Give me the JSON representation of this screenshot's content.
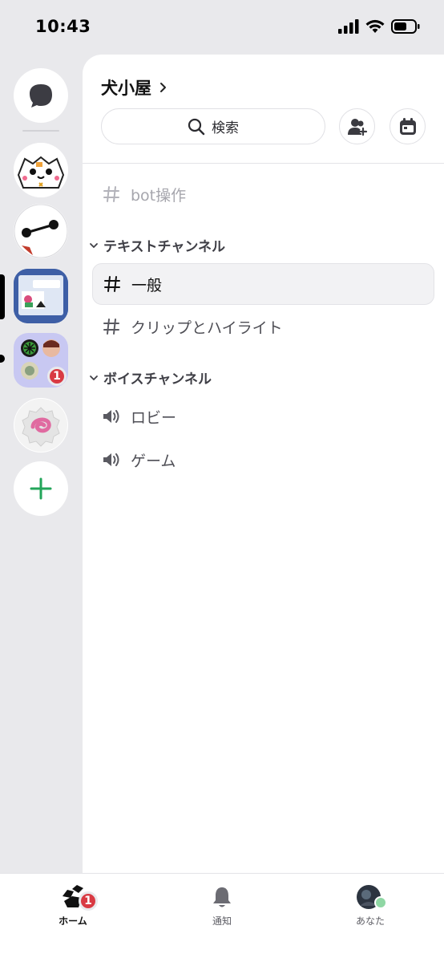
{
  "status": {
    "time": "10:43"
  },
  "guild": {
    "name": "犬小屋"
  },
  "search": {
    "label": "検索"
  },
  "channels": {
    "top": {
      "label": "bot操作"
    },
    "text_category": "テキストチャンネル",
    "text": [
      {
        "label": "一般"
      },
      {
        "label": "クリップとハイライト"
      }
    ],
    "voice_category": "ボイスチャンネル",
    "voice": [
      {
        "label": "ロビー"
      },
      {
        "label": "ゲーム"
      }
    ]
  },
  "servers": {
    "group_badge": "1"
  },
  "tabs": {
    "home": {
      "label": "ホーム",
      "badge": "1"
    },
    "notifications": {
      "label": "通知"
    },
    "you": {
      "label": "あなた"
    }
  },
  "colors": {
    "accent_green": "#23a55a",
    "badge_red": "#d93a43"
  }
}
